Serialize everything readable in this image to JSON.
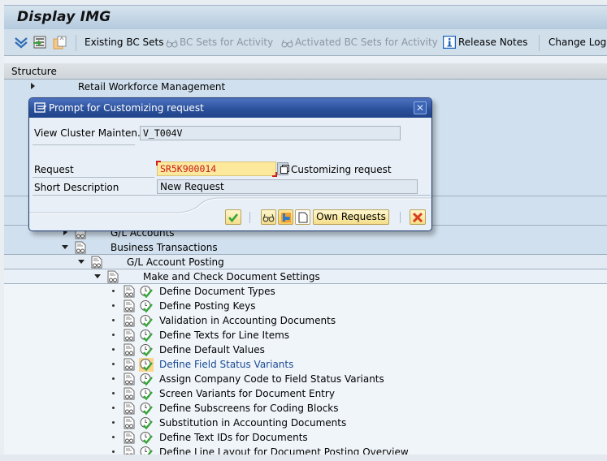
{
  "window": {
    "title": "Display IMG"
  },
  "toolbar": {
    "icons": [
      "expand-all-icon",
      "execute-icon",
      "transport-icon"
    ],
    "existing_bc_sets": "Existing BC Sets",
    "bc_sets_for_activity": "BC Sets for Activity",
    "activated_bc_sets": "Activated BC Sets for Activity",
    "release_notes": "Release Notes",
    "change_log": "Change Log"
  },
  "structure": {
    "header": "Structure",
    "nodes": [
      {
        "label": "Retail Workforce Management",
        "level": 0,
        "state": "collapsed"
      },
      {
        "label": "G/L Accounts",
        "level": 2,
        "state": "collapsed"
      },
      {
        "label": "Business Transactions",
        "level": 2,
        "state": "expanded"
      },
      {
        "label": "G/L Account Posting",
        "level": 3,
        "state": "expanded"
      },
      {
        "label": "Make and Check Document Settings",
        "level": 4,
        "state": "expanded"
      }
    ],
    "activities": [
      {
        "label": "Define Document Types",
        "selected": false
      },
      {
        "label": "Define Posting Keys",
        "selected": false
      },
      {
        "label": "Validation in Accounting Documents",
        "selected": false
      },
      {
        "label": "Define Texts for Line Items",
        "selected": false
      },
      {
        "label": "Define Default Values",
        "selected": false
      },
      {
        "label": "Define Field Status Variants",
        "selected": true
      },
      {
        "label": "Assign Company Code to Field Status Variants",
        "selected": false
      },
      {
        "label": "Screen Variants for Document Entry",
        "selected": false
      },
      {
        "label": "Define Subscreens for Coding Blocks",
        "selected": false
      },
      {
        "label": "Substitution in Accounting Documents",
        "selected": false
      },
      {
        "label": "Define Text IDs for Documents",
        "selected": false
      },
      {
        "label": "Define Line Layout for Document Posting Overview",
        "selected": false
      }
    ]
  },
  "dialog": {
    "title": "Prompt for Customizing request",
    "object_label": "View Cluster Mainten...",
    "object_value": "V_T004V",
    "request_label": "Request",
    "request_value": "SR5K900014",
    "request_type": "Customizing request",
    "short_desc_label": "Short Description",
    "short_desc_value": "New Request",
    "buttons": {
      "confirm": "Continue",
      "display": "Display",
      "change": "Change",
      "create": "Create Request",
      "own_requests": "Own Requests",
      "cancel": "Cancel"
    }
  },
  "colors": {
    "dialog_title": "#2a4f99",
    "required_field": "#fde99c",
    "request_text": "#c41a1a",
    "selected_link": "#1a4a93",
    "selected_highlight": "#fbd589"
  }
}
